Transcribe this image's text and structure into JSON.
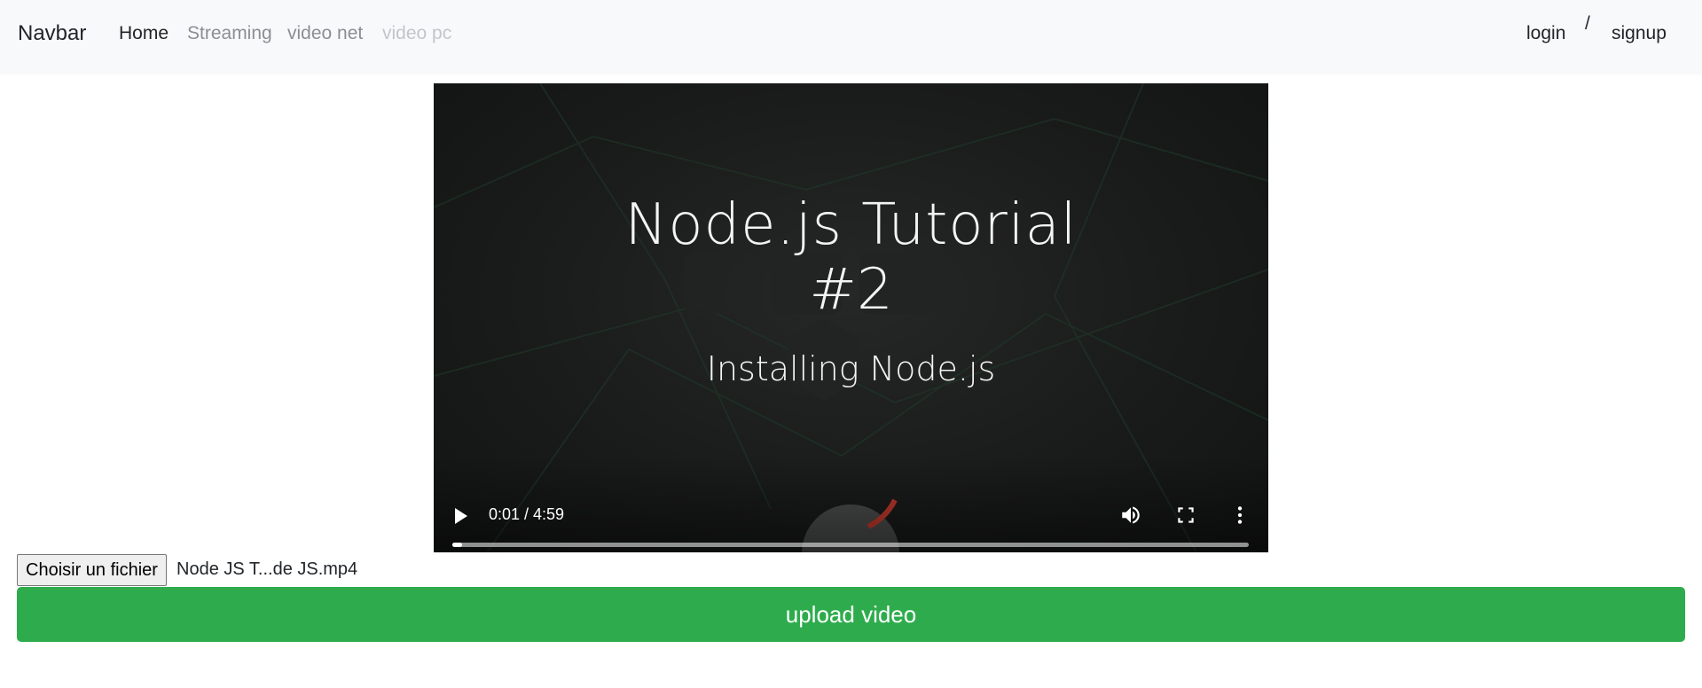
{
  "navbar": {
    "brand": "Navbar",
    "links": [
      {
        "label": "Home",
        "state": "active"
      },
      {
        "label": "Streaming",
        "state": "normal"
      },
      {
        "label": "video net",
        "state": "normal"
      },
      {
        "label": "video pc",
        "state": "disabled"
      }
    ],
    "login": "login",
    "separator": "/",
    "signup": "signup"
  },
  "video": {
    "title_line1": "Node.js Tutorial",
    "title_line2": "#2",
    "subtitle": "Installing Node.js",
    "time_display": "0:01 / 4:59",
    "progress_fraction": 0.012,
    "icons": [
      "play-icon",
      "volume-icon",
      "fullscreen-icon",
      "more-options-icon"
    ]
  },
  "upload_form": {
    "choose_file_label": "Choisir un fichier",
    "file_name": "Node JS T...de JS.mp4",
    "upload_label": "upload video"
  },
  "colors": {
    "navbar_bg": "#f8f9fa",
    "upload_button": "#2eac4d"
  }
}
